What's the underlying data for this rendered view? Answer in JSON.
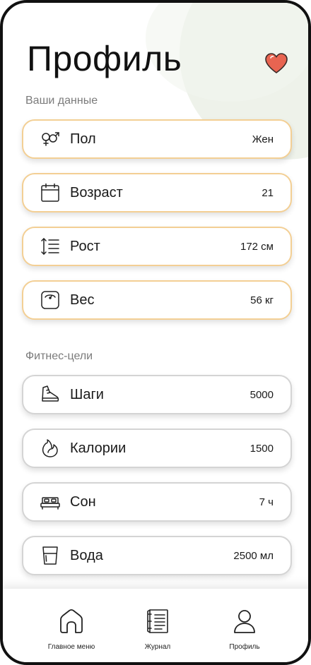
{
  "header": {
    "title": "Профиль",
    "favorite_icon": "heart-icon",
    "favorite_color": "#e86451"
  },
  "personal": {
    "section_label": "Ваши данные",
    "accent_border": "#f3cf94",
    "items": [
      {
        "label": "Пол",
        "value": "Жен",
        "icon": "gender-icon"
      },
      {
        "label": "Возраст",
        "value": "21",
        "icon": "calendar-icon"
      },
      {
        "label": "Рост",
        "value": "172 см",
        "icon": "height-icon"
      },
      {
        "label": "Вес",
        "value": "56 кг",
        "icon": "scale-icon"
      }
    ]
  },
  "goals": {
    "section_label": "Фитнес-цели",
    "accent_border": "#d4d4d4",
    "items": [
      {
        "label": "Шаги",
        "value": "5000",
        "icon": "sneaker-icon"
      },
      {
        "label": "Калории",
        "value": "1500",
        "icon": "flame-icon"
      },
      {
        "label": "Сон",
        "value": "7 ч",
        "icon": "bed-icon"
      },
      {
        "label": "Вода",
        "value": "2500 мл",
        "icon": "water-glass-icon"
      }
    ]
  },
  "tabbar": {
    "tabs": [
      {
        "label": "Главное меню",
        "icon": "home-icon"
      },
      {
        "label": "Журнал",
        "icon": "journal-icon"
      },
      {
        "label": "Профиль",
        "icon": "user-icon"
      }
    ]
  }
}
